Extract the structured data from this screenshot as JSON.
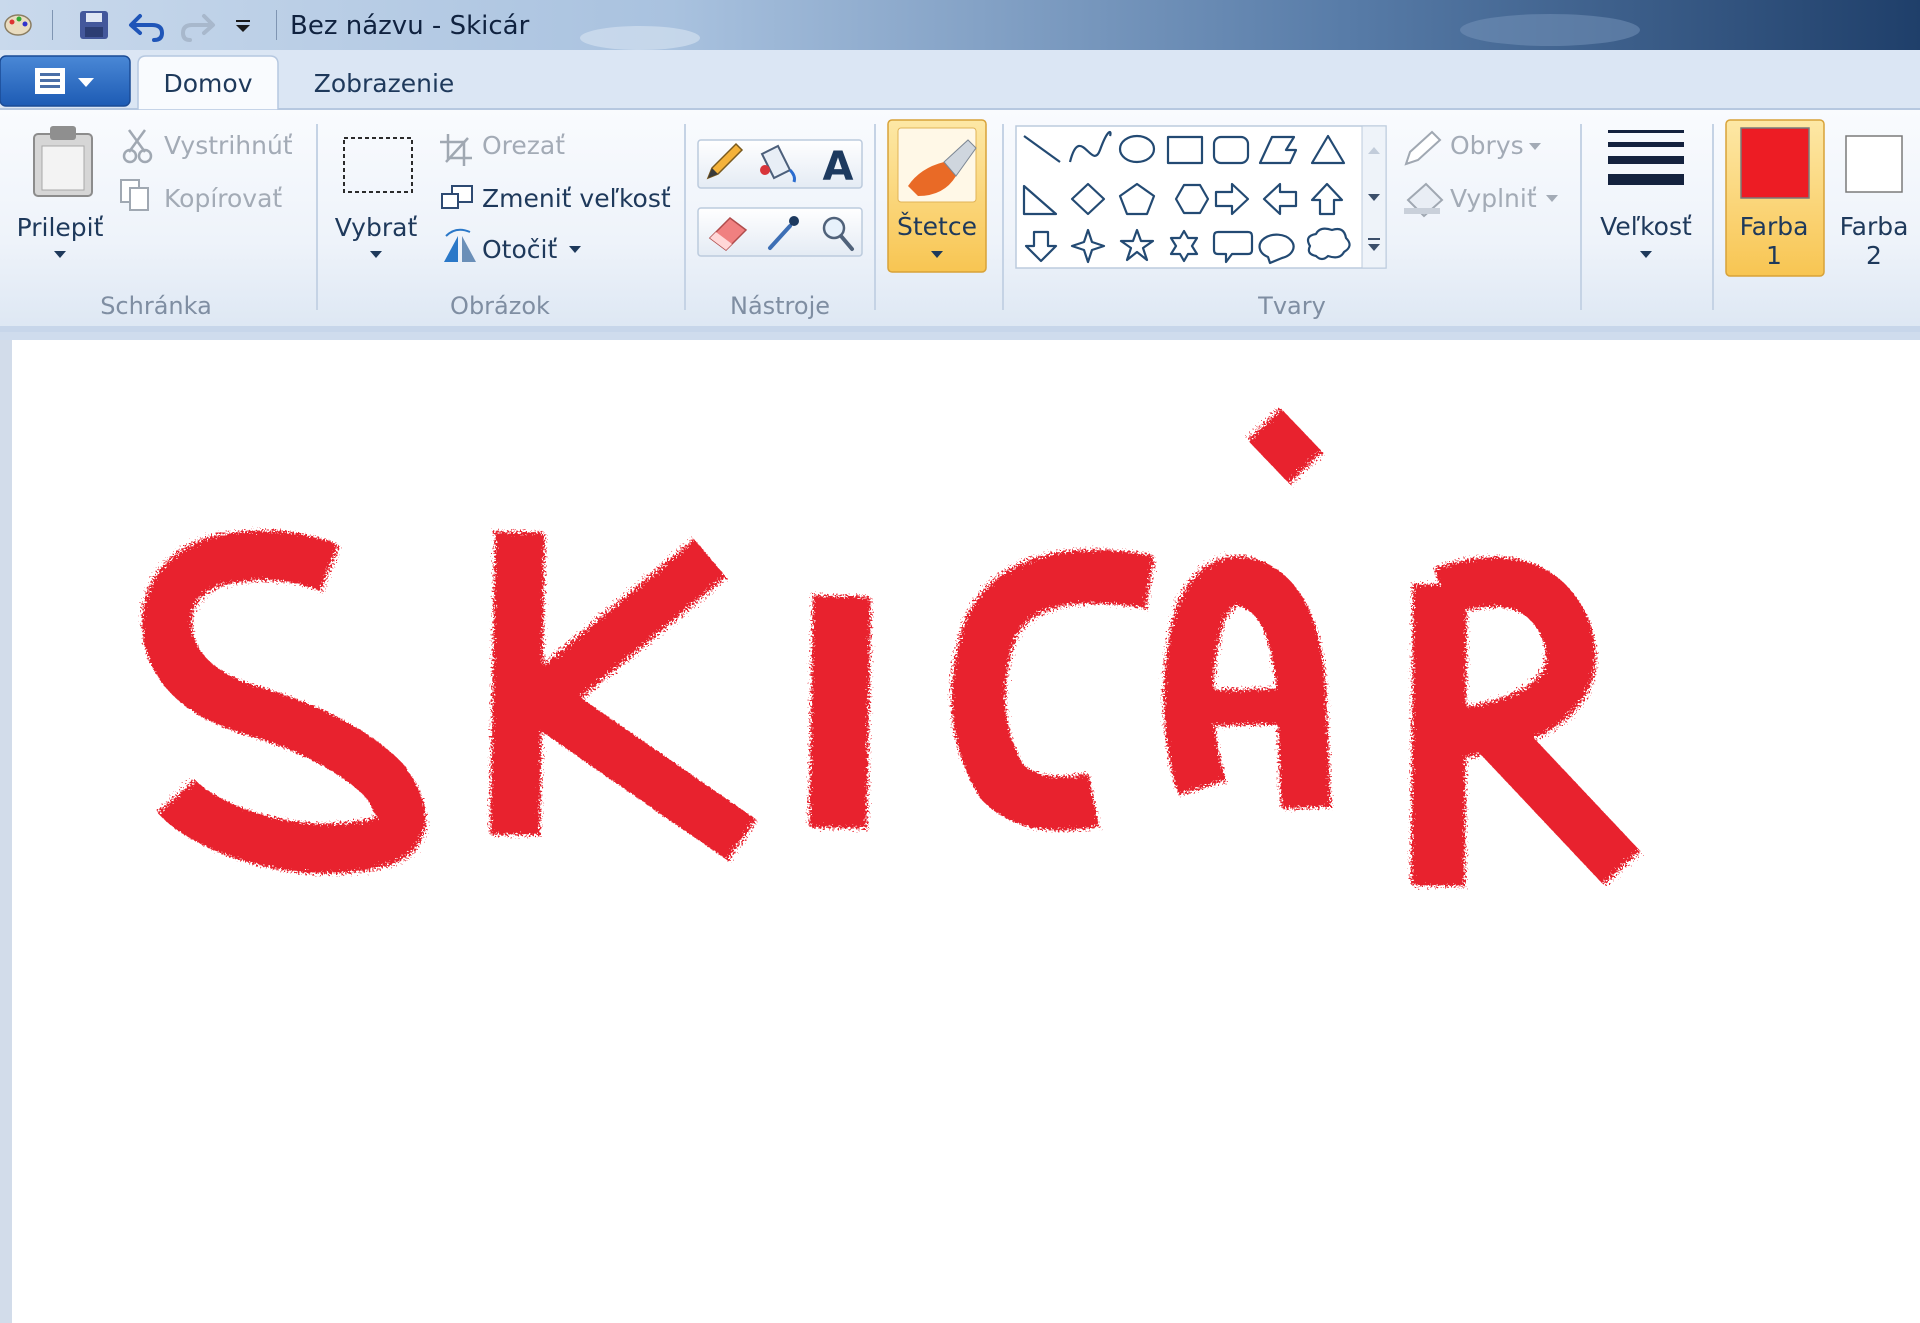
{
  "window": {
    "title": "Bez názvu - Skicár"
  },
  "tabs": {
    "domov": "Domov",
    "zobrazenie": "Zobrazenie"
  },
  "groups": {
    "schranka": "Schránka",
    "obrazok": "Obrázok",
    "nastroje": "Nástroje",
    "tvary": "Tvary"
  },
  "clipboard": {
    "paste": "Prilepiť",
    "cut": "Vystrihnúť",
    "copy": "Kopírovať"
  },
  "image": {
    "select": "Vybrať",
    "crop": "Orezať",
    "resize": "Zmeniť veľkosť",
    "rotate": "Otočiť"
  },
  "brushes": {
    "label": "Štetce"
  },
  "shapes": {
    "outline": "Obrys",
    "fill": "Vyplniť"
  },
  "size": {
    "label": "Veľkosť"
  },
  "colors": {
    "color1_line1": "Farba",
    "color1_line2": "1",
    "color2_line1": "Farba",
    "color2_line2": "2",
    "color1_hex": "#ed1c24",
    "color2_hex": "#ffffff"
  },
  "canvas": {
    "drawn_text": "SKICÁR",
    "stroke_color": "#e8242e"
  }
}
